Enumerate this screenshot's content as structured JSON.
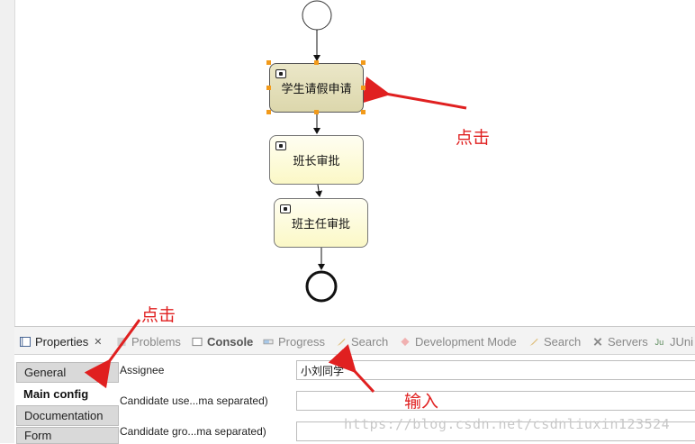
{
  "diagram": {
    "tasks": [
      {
        "name": "学生请假申请",
        "selected": true
      },
      {
        "name": "班长审批",
        "selected": false
      },
      {
        "name": "班主任审批",
        "selected": false
      }
    ]
  },
  "annotations": {
    "click_task": "点击",
    "click_general": "点击",
    "input": "输入"
  },
  "panel_tabs": [
    {
      "label": "Properties",
      "icon": "properties-icon",
      "active": true
    },
    {
      "label": "Problems",
      "icon": "problems-icon"
    },
    {
      "label": "Console",
      "icon": "console-icon"
    },
    {
      "label": "Progress",
      "icon": "progress-icon"
    },
    {
      "label": "Search",
      "icon": "search-icon"
    },
    {
      "label": "Development Mode",
      "icon": "development-mode-icon"
    },
    {
      "label": "Search",
      "icon": "search-icon"
    },
    {
      "label": "Servers",
      "icon": "servers-icon"
    },
    {
      "label": "JUni",
      "icon": "junit-icon"
    }
  ],
  "properties": {
    "side_tabs": [
      "General",
      "Main config",
      "Documentation",
      "Form"
    ],
    "active_side_tab": "Main config",
    "fields": [
      {
        "label": "Assignee",
        "value": "小刘同学"
      },
      {
        "label": "Candidate use...ma separated)",
        "value": ""
      },
      {
        "label": "Candidate gro...ma separated)",
        "value": ""
      }
    ]
  },
  "watermark": "https://blog.csdn.net/csdnliuxin123524",
  "colors": {
    "annotation": "#e02020",
    "selection_handle": "#f29a1a",
    "task_fill": "#fbf8c6",
    "selected_task_fill": "#dcd7ac"
  }
}
